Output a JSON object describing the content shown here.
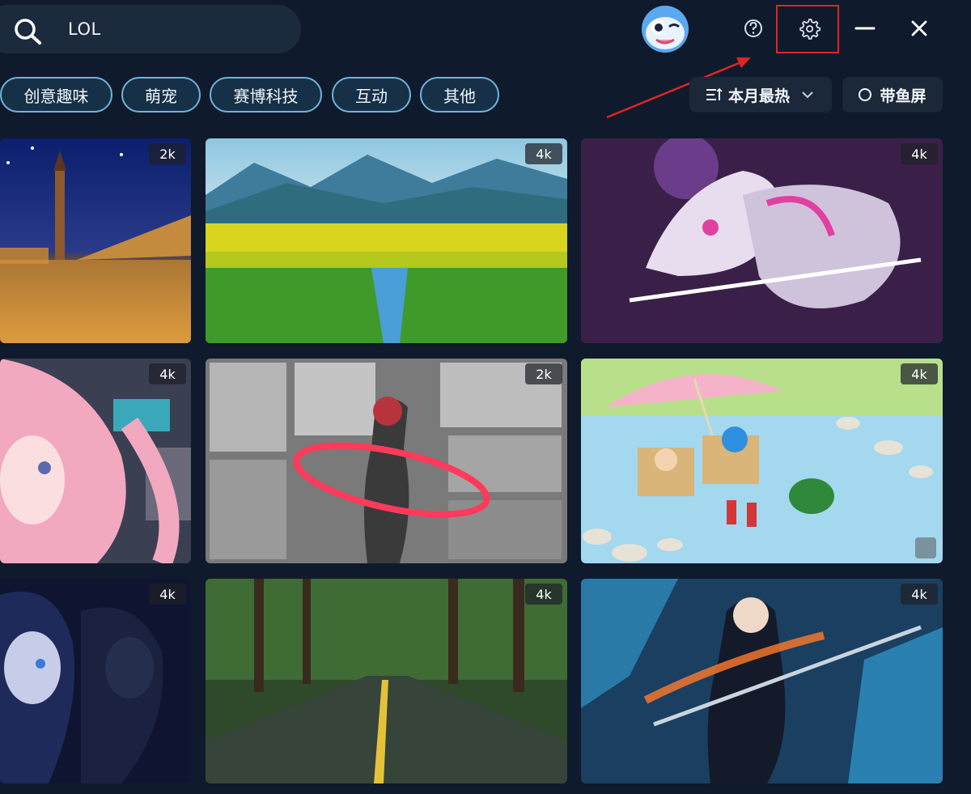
{
  "search": {
    "value": "LOL"
  },
  "window": {
    "help": "help-icon",
    "settings": "gear-icon",
    "minimize": "minimize-icon",
    "close": "close-icon"
  },
  "categories": [
    "创意趣味",
    "萌宠",
    "赛博科技",
    "互动",
    "其他"
  ],
  "sort": {
    "label": "本月最热"
  },
  "fish_screen": {
    "label": "带鱼屏"
  },
  "wallpapers": [
    {
      "resolution": "2k",
      "theme": "venice-night"
    },
    {
      "resolution": "4k",
      "theme": "rice-field-valley"
    },
    {
      "resolution": "4k",
      "theme": "white-dragon-samurai"
    },
    {
      "resolution": "4k",
      "theme": "pink-hair-anime-girl"
    },
    {
      "resolution": "2k",
      "theme": "manga-red-hair-girl"
    },
    {
      "resolution": "4k",
      "theme": "crayon-shin-chan-doraemon-beach"
    },
    {
      "resolution": "4k",
      "theme": "detective-anime-night"
    },
    {
      "resolution": "4k",
      "theme": "forest-road-rain"
    },
    {
      "resolution": "4k",
      "theme": "samurai-sword-fire"
    }
  ],
  "colors": {
    "background": "#0f1a2c",
    "chip_border": "#6fb4d9",
    "highlight": "#e02424"
  }
}
